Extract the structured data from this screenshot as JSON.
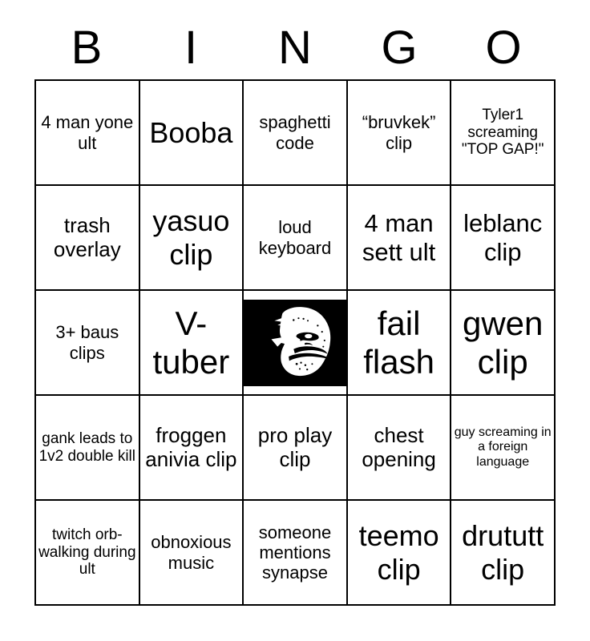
{
  "card": {
    "title": "BINGO",
    "header_letters": [
      "B",
      "I",
      "N",
      "G",
      "O"
    ],
    "grid_size": "5x5",
    "colors": {
      "background": "#ffffff",
      "border": "#000000",
      "text": "#000000",
      "free_space_background": "#000000",
      "free_space_figure": "#ffffff"
    },
    "rows": [
      [
        {
          "text": "4 man yone ult",
          "size": "m"
        },
        {
          "text": "Booba",
          "size": "xxl"
        },
        {
          "text": "spaghetti code",
          "size": "m"
        },
        {
          "text": "“bruvkek” clip",
          "size": "m"
        },
        {
          "text": "Tyler1 screaming \"TOP GAP!\"",
          "size": "s"
        }
      ],
      [
        {
          "text": "trash overlay",
          "size": "l"
        },
        {
          "text": "yasuo clip",
          "size": "xxl"
        },
        {
          "text": "loud keyboard",
          "size": "m"
        },
        {
          "text": "4 man sett ult",
          "size": "xl"
        },
        {
          "text": "leblanc clip",
          "size": "xl"
        }
      ],
      [
        {
          "text": "3+ baus clips",
          "size": "m"
        },
        {
          "text": "V-tuber",
          "size": "huge"
        },
        {
          "text": "",
          "size": "m",
          "free_space": true,
          "icon": "trollface-icon"
        },
        {
          "text": "fail flash",
          "size": "huge"
        },
        {
          "text": "gwen clip",
          "size": "huge"
        }
      ],
      [
        {
          "text": "gank leads to 1v2 double kill",
          "size": "s"
        },
        {
          "text": "froggen anivia clip",
          "size": "l"
        },
        {
          "text": "pro play clip",
          "size": "l"
        },
        {
          "text": "chest opening",
          "size": "l"
        },
        {
          "text": "guy screaming in a foreign language",
          "size": "xs"
        }
      ],
      [
        {
          "text": "twitch orb-walking during ult",
          "size": "s"
        },
        {
          "text": "obnoxious music",
          "size": "m"
        },
        {
          "text": "someone mentions synapse",
          "size": "m"
        },
        {
          "text": "teemo clip",
          "size": "xxl"
        },
        {
          "text": "drututt clip",
          "size": "xxl"
        }
      ]
    ]
  }
}
